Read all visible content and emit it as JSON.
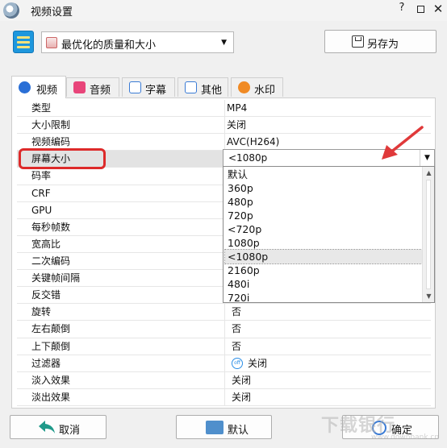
{
  "window": {
    "title": "视频设置",
    "help": "?",
    "close": "✕"
  },
  "preset": {
    "selected": "最优化的质量和大小",
    "save_as": "另存为"
  },
  "tabs": [
    {
      "label": "视频",
      "active": true
    },
    {
      "label": "音频",
      "active": false
    },
    {
      "label": "字幕",
      "active": false
    },
    {
      "label": "其他",
      "active": false
    },
    {
      "label": "水印",
      "active": false
    }
  ],
  "settings": [
    {
      "key": "类型",
      "value": "MP4"
    },
    {
      "key": "大小限制",
      "value": "关闭"
    },
    {
      "key": "视频编码",
      "value": "AVC(H264)"
    },
    {
      "key": "屏幕大小",
      "value": "<1080p"
    },
    {
      "key": "码率",
      "value": ""
    },
    {
      "key": "CRF",
      "value": ""
    },
    {
      "key": "GPU",
      "value": ""
    },
    {
      "key": "每秒帧数",
      "value": ""
    },
    {
      "key": "宽高比",
      "value": ""
    },
    {
      "key": "二次编码",
      "value": ""
    },
    {
      "key": "关键帧间隔",
      "value": ""
    },
    {
      "key": "反交错",
      "value": ""
    },
    {
      "key": "旋转",
      "value": "否"
    },
    {
      "key": "左右颠倒",
      "value": "否"
    },
    {
      "key": "上下颠倒",
      "value": "否"
    },
    {
      "key": "过滤器",
      "value": "关闭",
      "badge": "off"
    },
    {
      "key": "淡入效果",
      "value": "关闭"
    },
    {
      "key": "淡出效果",
      "value": "关闭"
    }
  ],
  "screen_size_dropdown": {
    "current": "<1080p",
    "options": [
      "默认",
      "360p",
      "480p",
      "720p",
      "<720p",
      "1080p",
      "<1080p",
      "2160p",
      "480i",
      "720i"
    ],
    "selected_index": 6
  },
  "buttons": {
    "cancel": "取消",
    "default": "默认",
    "ok": "确定"
  },
  "watermark": {
    "brand": "下载银行",
    "url": "www.downbank.cn"
  },
  "colors": {
    "highlight": "#dd2a2a",
    "arrow": "#e0393a",
    "accent": "#2a6fd6"
  }
}
